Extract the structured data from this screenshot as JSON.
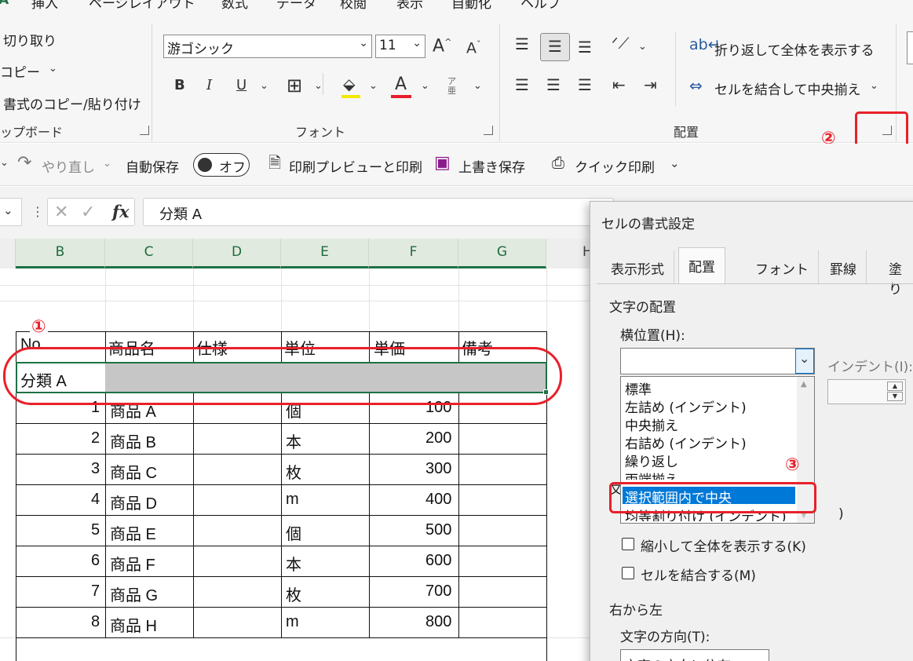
{
  "ribbon": {
    "tabs": [
      "A",
      "挿入",
      "ページレイアウト",
      "数式",
      "データ",
      "校閲",
      "表示",
      "自動化",
      "ヘルプ"
    ],
    "clipboard": {
      "cut": "切り取り",
      "copy": "コピー",
      "format_painter": "書式のコピー/貼り付け",
      "group": "ップボード"
    },
    "font": {
      "name": "游ゴシック",
      "size": "11",
      "grow": "A^",
      "shrink": "Aˇ",
      "bold": "B",
      "italic": "I",
      "underline": "U",
      "phonetic": "ア亜",
      "group": "フォント"
    },
    "alignment": {
      "wrap": "折り返して全体を表示する",
      "merge": "セルを結合して中央揃え",
      "group": "配置"
    }
  },
  "qat": {
    "redo": "やり直し",
    "autosave": "自動保存",
    "autosave_state": "オフ",
    "print_preview": "印刷プレビューと印刷",
    "save": "上書き保存",
    "quick_print": "クイック印刷"
  },
  "formula_bar": {
    "fx": "fx",
    "value": "分類 A"
  },
  "columns": [
    "B",
    "C",
    "D",
    "E",
    "F",
    "G",
    "H"
  ],
  "table": {
    "headers": [
      "No",
      "商品名",
      "仕様",
      "単位",
      "単価",
      "備考"
    ],
    "category": "分類 A",
    "rows": [
      {
        "no": "1",
        "name": "商品 A",
        "unit": "個",
        "price": "100"
      },
      {
        "no": "2",
        "name": "商品 B",
        "unit": "本",
        "price": "200"
      },
      {
        "no": "3",
        "name": "商品 C",
        "unit": "枚",
        "price": "300"
      },
      {
        "no": "4",
        "name": "商品 D",
        "unit": "m",
        "price": "400"
      },
      {
        "no": "5",
        "name": "商品 E",
        "unit": "個",
        "price": "500"
      },
      {
        "no": "6",
        "name": "商品 F",
        "unit": "本",
        "price": "600"
      },
      {
        "no": "7",
        "name": "商品 G",
        "unit": "枚",
        "price": "700"
      },
      {
        "no": "8",
        "name": "商品 H",
        "unit": "m",
        "price": "800"
      }
    ]
  },
  "dialog": {
    "title": "セルの書式設定",
    "tabs": [
      "表示形式",
      "配置",
      "フォント",
      "罫線",
      "塗り"
    ],
    "section_alignment": "文字の配置",
    "horizontal_label": "横位置(H):",
    "indent_label": "インデント(I):",
    "options": [
      "標準",
      "左詰め (インデント)",
      "中央揃え",
      "右詰め (インデント)",
      "繰り返し",
      "両端揃え",
      "選択範囲内で中央",
      "均等割り付け (インデント)"
    ],
    "selected_option": "選択範囲内で中央",
    "shrink_label": "縮小して全体を表示する(K)",
    "merge_label": "セルを結合する(M)",
    "rtl_section": "右から左",
    "direction_label": "文字の方向(T):",
    "direction_value": "文字の方向に依存"
  },
  "annotations": {
    "one": "①",
    "two": "②",
    "three": "③"
  },
  "colors": {
    "excel_green": "#1e7145",
    "annotation_red": "#e8202a",
    "selection_blue": "#0078d7"
  }
}
